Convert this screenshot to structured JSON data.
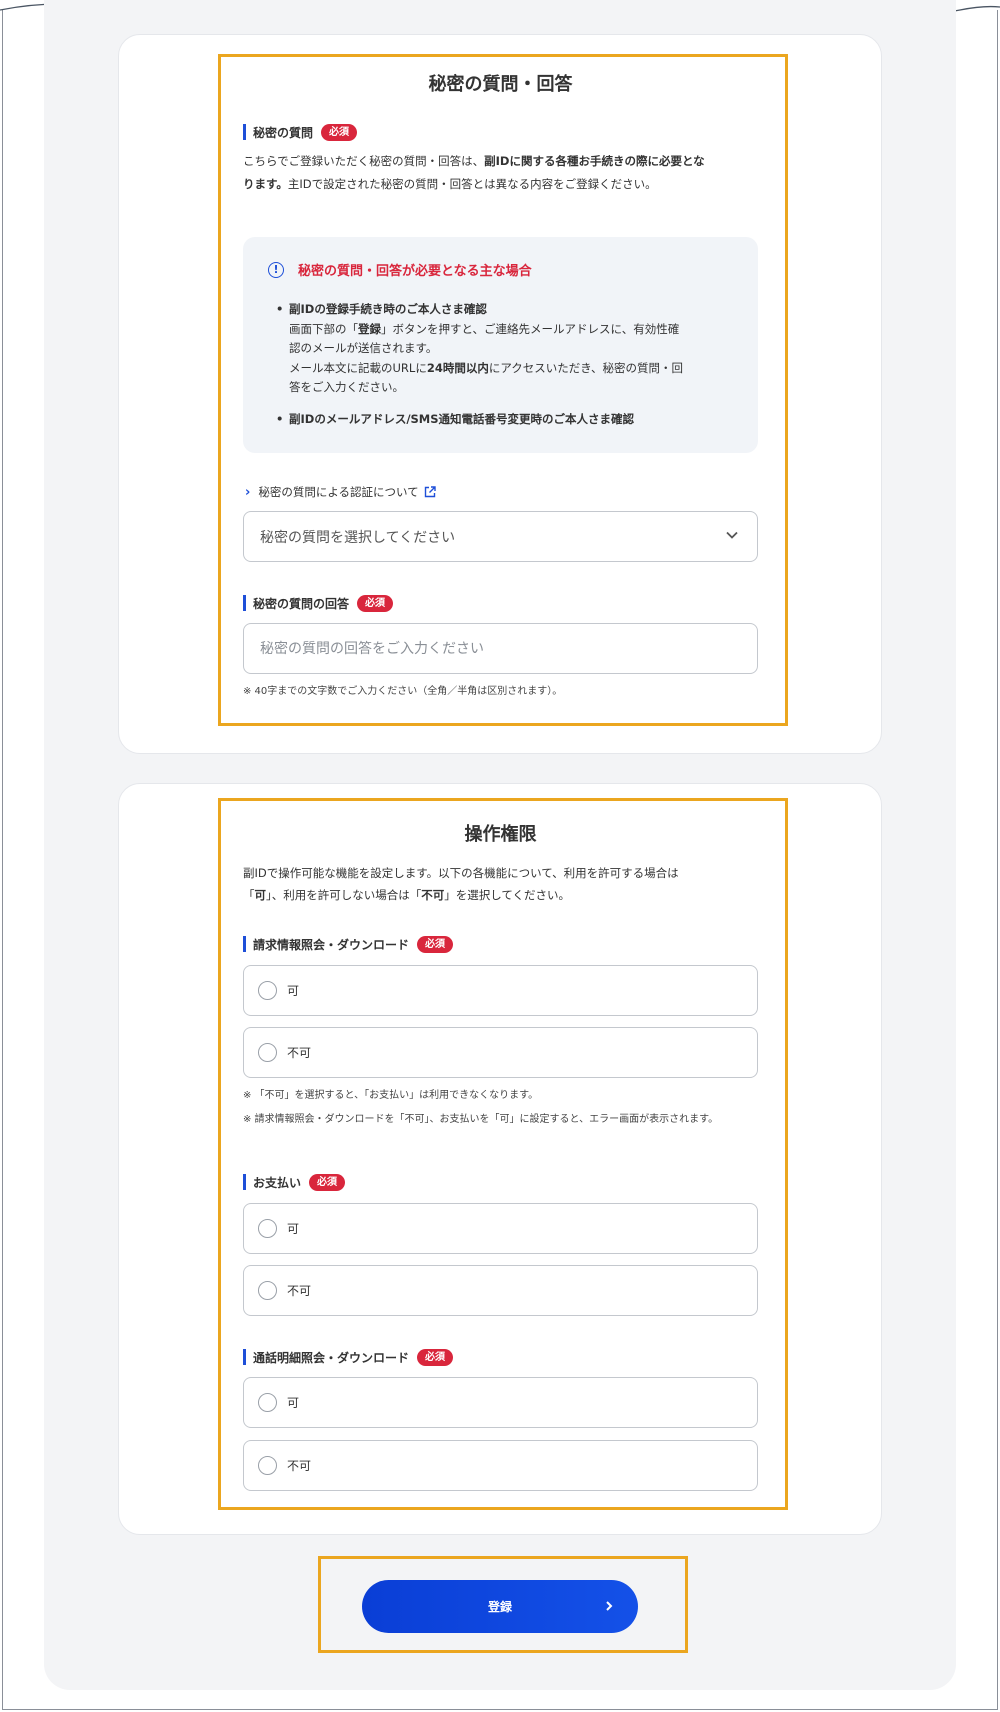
{
  "secret_section": {
    "title": "秘密の質問・回答",
    "question_label": "秘密の質問",
    "required_badge": "必須",
    "intro_1": "こちらでご登録いただく秘密の質問・回答は、",
    "intro_bold": "副IDに関する各種お手続きの際に必要とな",
    "intro_bold_2": "ります。",
    "intro_2": "主IDで設定された秘密の質問・回答とは異なる内容をご登録ください。",
    "info_title": "秘密の質問・回答が必要となる主な場合",
    "info_icon": "!",
    "bullet_dot": "•",
    "info_item1_title": "副IDの登録手続き時のご本人さま確認",
    "info_item1_a": "画面下部の「",
    "info_item1_a_bold": "登録",
    "info_item1_a2": "」ボタンを押すと、ご連絡先メールアドレスに、有効性確",
    "info_item1_b": "認のメールが送信されます。",
    "info_item1_c": "メール本文に記載のURLに",
    "info_item1_c_bold": "24時間以内",
    "info_item1_c2": "にアクセスいただき、秘密の質問・回",
    "info_item1_d": "答をご入力ください。",
    "info_item2_title": "副IDのメールアドレス/SMS通知電話番号変更時のご本人さま確認",
    "link_text": "秘密の質問による認証について",
    "select_placeholder": "秘密の質問を選択してください",
    "answer_label": "秘密の質問の回答",
    "answer_placeholder": "秘密の質問の回答をご入力ください",
    "answer_note": "※ 40字までの文字数でご入力ください（全角／半角は区別されます）。"
  },
  "permission_section": {
    "title": "操作権限",
    "intro_1": "副IDで操作可能な機能を設定します。以下の各機能について、利用を許可する場合は",
    "intro_2a": "「",
    "intro_2_bold1": "可",
    "intro_2b": "」、利用を許可しない場合は「",
    "intro_2_bold2": "不可",
    "intro_2c": "」を選択してください。",
    "required_badge": "必須",
    "groups": [
      {
        "label": "請求情報照会・ダウンロード",
        "options": [
          "可",
          "不可"
        ]
      },
      {
        "label": "お支払い",
        "options": [
          "可",
          "不可"
        ]
      },
      {
        "label": "通話明細照会・ダウンロード",
        "options": [
          "可",
          "不可"
        ]
      }
    ],
    "note_1": "※ 「不可」を選択すると、「お支払い」は利用できなくなります。",
    "note_2": "※ 請求情報照会・ダウンロードを「不可」、お支払いを「可」に設定すると、エラー画面が表示されます。"
  },
  "register_button": {
    "label": "登録"
  },
  "colors": {
    "accent_blue": "#1e4fd8",
    "required_red": "#d9263c",
    "highlight_orange": "#eba61f",
    "button_blue": "#0a3ed6"
  },
  "icons": [
    "info-icon",
    "chevron-right-icon",
    "external-link-icon",
    "chevron-down-icon",
    "radio-icon"
  ]
}
